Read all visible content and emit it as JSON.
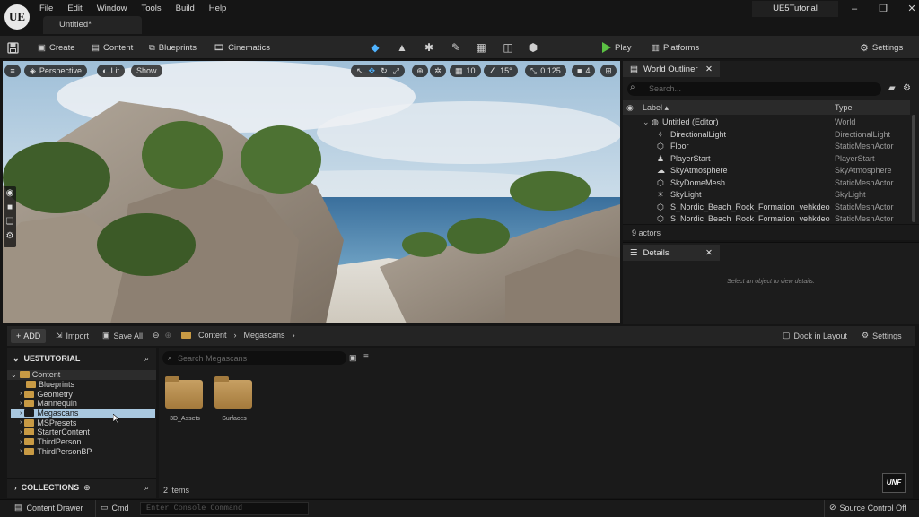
{
  "app": {
    "logo": "UE",
    "menu": [
      "File",
      "Edit",
      "Window",
      "Tools",
      "Build",
      "Help"
    ],
    "document_tab": "Untitled*",
    "project_name": "UE5Tutorial",
    "window_controls": {
      "minimize": "–",
      "maximize": "❐",
      "close": "✕"
    }
  },
  "toolbar": {
    "save_icon": "save-icon",
    "create": "Create",
    "content": "Content",
    "blueprints": "Blueprints",
    "cinematics": "Cinematics",
    "play": "Play",
    "platforms": "Platforms",
    "settings": "Settings"
  },
  "viewport": {
    "perspective": "Perspective",
    "lit": "Lit",
    "show": "Show",
    "grid_snap": "10",
    "rotation_snap": "15°",
    "scale_snap": "0.125",
    "camera_speed": "4"
  },
  "outliner": {
    "title": "World Outliner",
    "search_placeholder": "Search...",
    "col_label": "Label ▴",
    "col_type": "Type",
    "rows": [
      {
        "label": "Untitled (Editor)",
        "type": "World"
      },
      {
        "label": "DirectionalLight",
        "type": "DirectionalLight"
      },
      {
        "label": "Floor",
        "type": "StaticMeshActor"
      },
      {
        "label": "PlayerStart",
        "type": "PlayerStart"
      },
      {
        "label": "SkyAtmosphere",
        "type": "SkyAtmosphere"
      },
      {
        "label": "SkyDomeMesh",
        "type": "StaticMeshActor"
      },
      {
        "label": "SkyLight",
        "type": "SkyLight"
      },
      {
        "label": "S_Nordic_Beach_Rock_Formation_vehkdeo",
        "type": "StaticMeshActor"
      },
      {
        "label": "S_Nordic_Beach_Rock_Formation_vehkdeo",
        "type": "StaticMeshActor"
      }
    ],
    "actor_count": "9 actors"
  },
  "details": {
    "title": "Details",
    "empty_message": "Select an object to view details."
  },
  "content_browser": {
    "add": "ADD",
    "import": "Import",
    "save_all": "Save All",
    "path": [
      "Content",
      "Megascans"
    ],
    "dock_in_layout": "Dock in Layout",
    "settings": "Settings",
    "project_root": "UE5TUTORIAL",
    "search_placeholder": "Search Megascans",
    "tree": [
      {
        "name": "Content",
        "level": 0,
        "expanded": true
      },
      {
        "name": "Blueprints",
        "level": 1
      },
      {
        "name": "Geometry",
        "level": 1
      },
      {
        "name": "Mannequin",
        "level": 1
      },
      {
        "name": "Megascans",
        "level": 1,
        "selected": true
      },
      {
        "name": "MSPresets",
        "level": 1
      },
      {
        "name": "StarterContent",
        "level": 1
      },
      {
        "name": "ThirdPerson",
        "level": 1
      },
      {
        "name": "ThirdPersonBP",
        "level": 1
      }
    ],
    "assets": [
      "3D_Assets",
      "Surfaces"
    ],
    "collections": "COLLECTIONS",
    "item_count": "2 items"
  },
  "statusbar": {
    "content_drawer": "Content Drawer",
    "cmd": "Cmd",
    "console_placeholder": "Enter Console Command",
    "source_control": "Source Control Off",
    "watermark": "UNF"
  },
  "colors": {
    "accent": "#4fb3ff",
    "play_green": "#5bc043",
    "folder": "#c89a44",
    "selection": "#a9c8e0"
  }
}
